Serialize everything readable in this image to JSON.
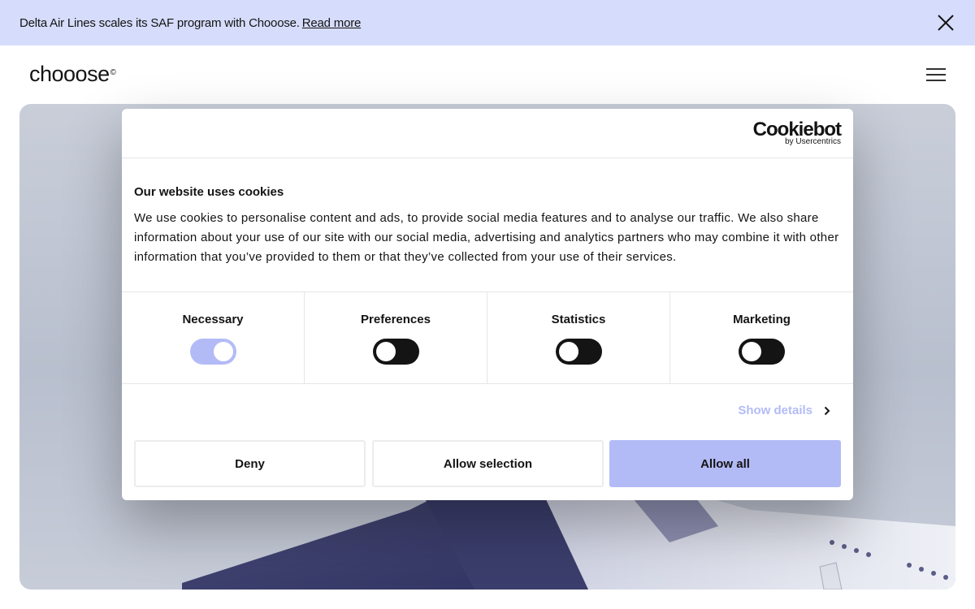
{
  "banner": {
    "text": "Delta Air Lines scales its SAF program with Chooose.",
    "link": "Read more",
    "close_icon": "close-icon"
  },
  "header": {
    "logo_text": "chooose",
    "logo_mark": "©",
    "menu_icon": "hamburger-menu-icon"
  },
  "cookie_dialog": {
    "brand_name": "Cookiebot",
    "brand_sub": "by Usercentrics",
    "title": "Our website uses cookies",
    "body": "We use cookies to personalise content and ads, to provide social media features and to analyse our traffic. We also share information about your use of our site with our social media, advertising and analytics partners who may combine it with other information that you’ve provided to them or that they’ve collected from your use of their services.",
    "categories": [
      {
        "label": "Necessary",
        "enabled": true
      },
      {
        "label": "Preferences",
        "enabled": false
      },
      {
        "label": "Statistics",
        "enabled": false
      },
      {
        "label": "Marketing",
        "enabled": false
      }
    ],
    "show_details": "Show details",
    "buttons": {
      "deny": "Deny",
      "allow_selection": "Allow selection",
      "allow_all": "Allow all"
    }
  },
  "colors": {
    "banner_bg": "#d6dcfb",
    "accent": "#b3bbf6",
    "text": "#141414"
  }
}
